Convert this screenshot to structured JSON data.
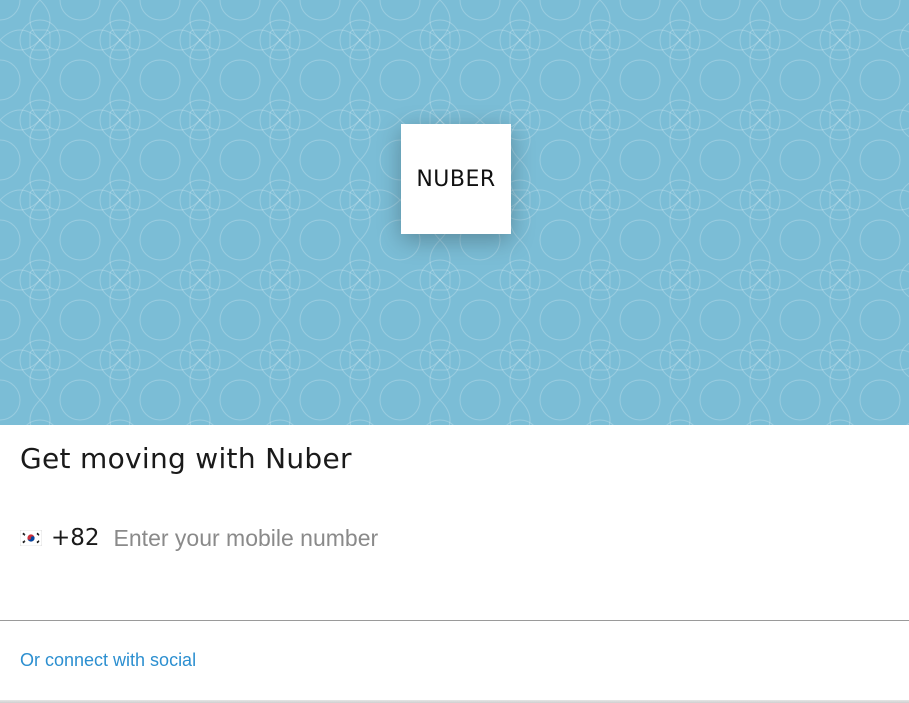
{
  "hero": {
    "background_color": "#7bbdd6",
    "logo_text": "NUBER"
  },
  "title": "Get moving with Nuber",
  "phone": {
    "flag_icon": "south-korea-flag-icon",
    "country_code": "+82",
    "placeholder": "Enter your mobile number",
    "value": ""
  },
  "social_link": {
    "label": "Or connect with social",
    "color": "#2c8fd0"
  }
}
